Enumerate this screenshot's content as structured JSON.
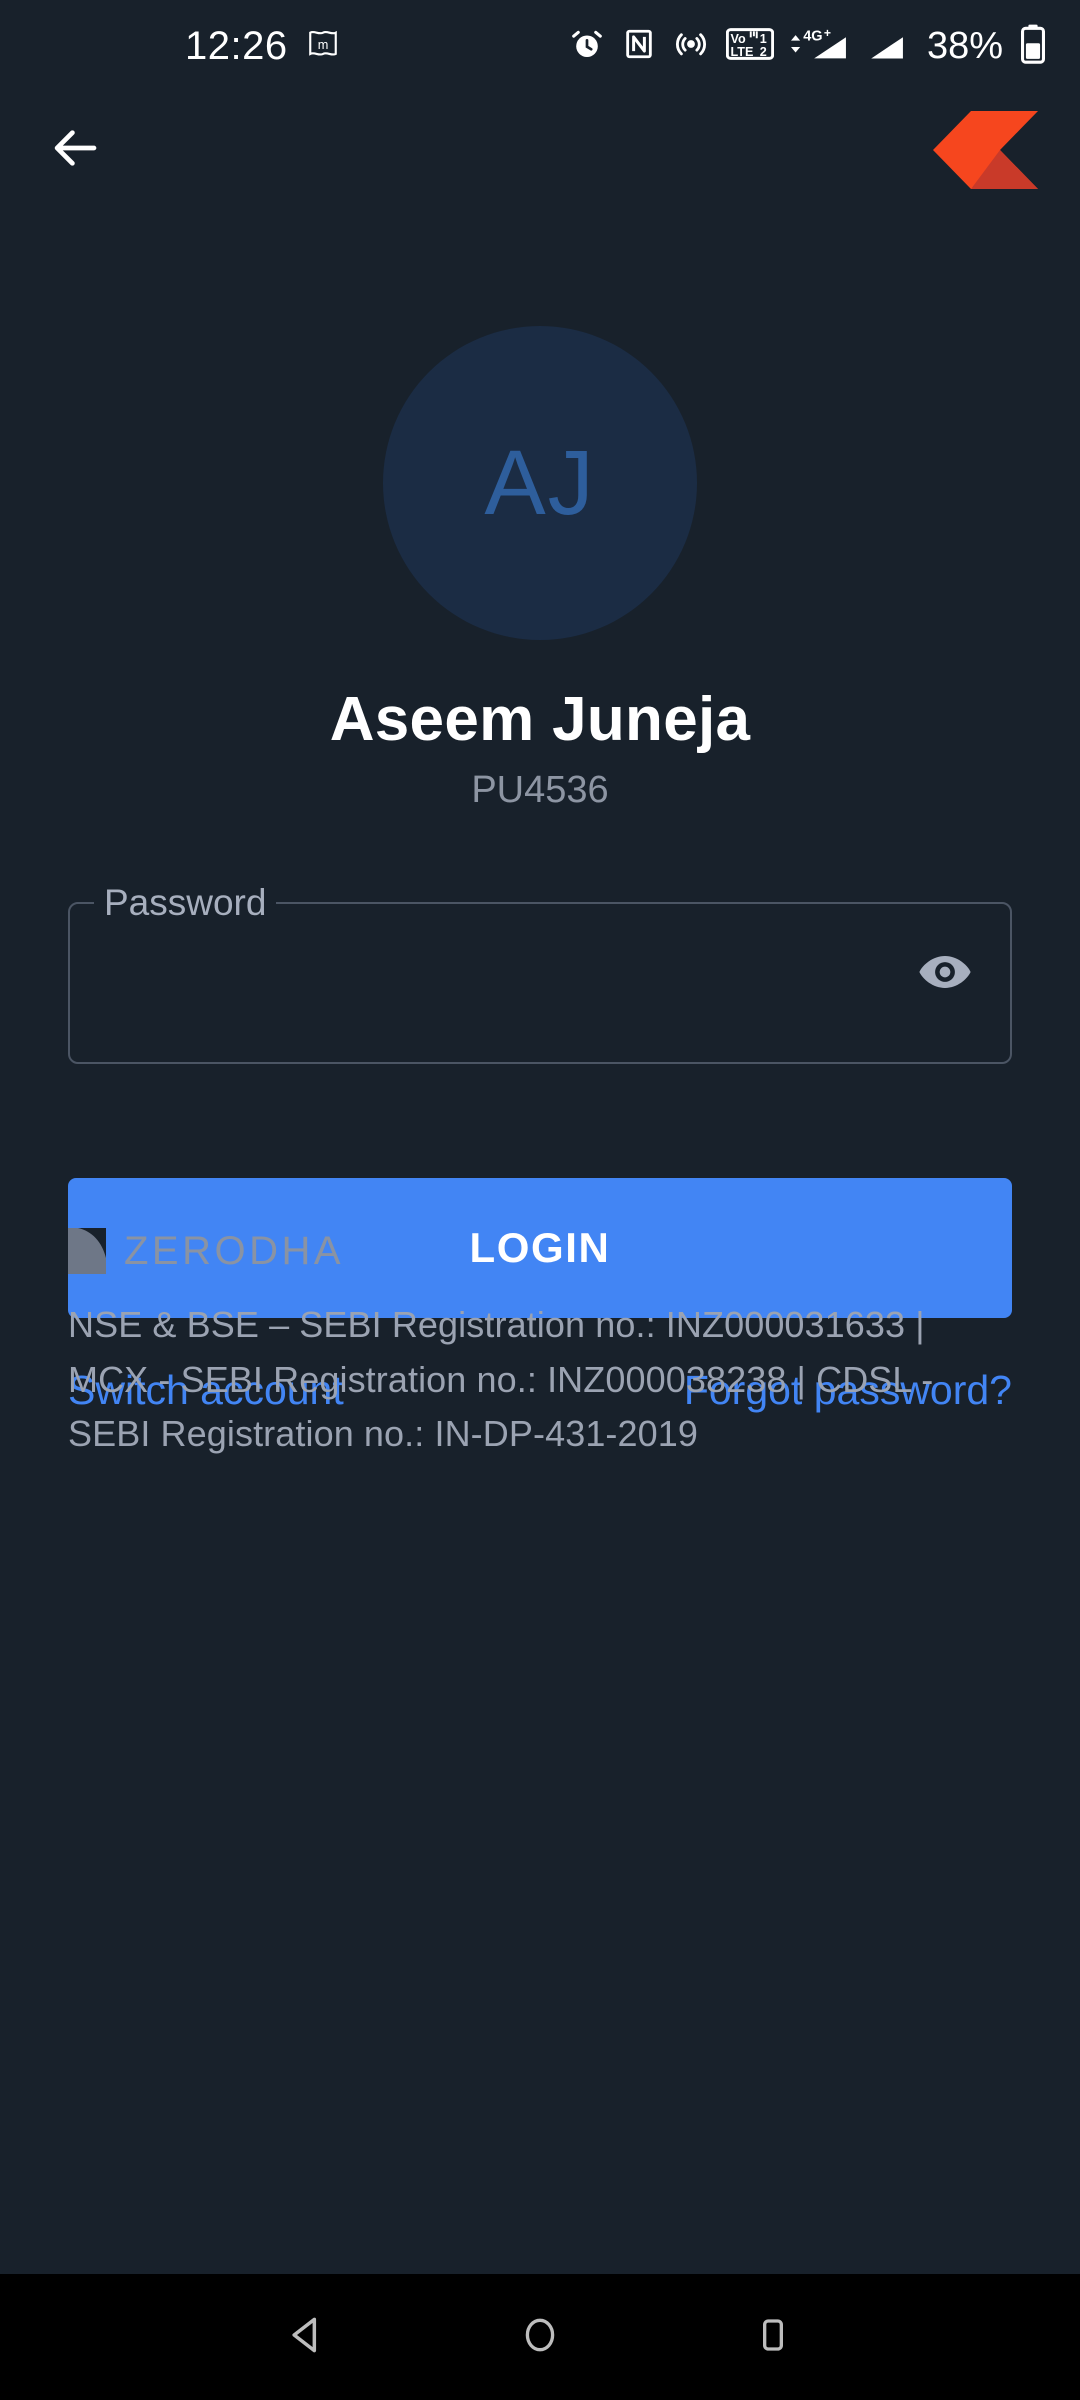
{
  "status_bar": {
    "time": "12:26",
    "notification_icon": "mastodon-flag-icon",
    "icons": [
      "alarm-icon",
      "nfc-icon",
      "hotspot-icon",
      "volte-dual-sim-icon",
      "signal-4g-plus-icon",
      "signal-sim2-icon"
    ],
    "battery_percent": "38%",
    "battery_icon": "battery-icon"
  },
  "app_bar": {
    "back_icon": "back-arrow-icon",
    "logo": "kite-logo",
    "logo_colors": {
      "primary": "#F6461E",
      "shadow": "#C93A29"
    }
  },
  "profile": {
    "initials": "AJ",
    "name": "Aseem Juneja",
    "user_id": "PU4536",
    "avatar_bg": "#1B2C44",
    "avatar_text_color": "#2E5E9C"
  },
  "form": {
    "password_label": "Password",
    "password_value": "",
    "password_placeholder": "",
    "toggle_visibility_icon": "eye-icon",
    "login_label": "LOGIN",
    "login_color": "#4285F4"
  },
  "links": {
    "switch_account": "Switch account",
    "forgot_password": "Forgot password?",
    "link_color": "#4285F4"
  },
  "footer": {
    "brand_mark": "zerodha-logo-icon",
    "brand_name": "ZERODHA",
    "legal": "NSE & BSE – SEBI Registration no.: INZ000031633 | MCX - SEBI Registration no.: INZ000038238 | CDSL - SEBI Registration no.: IN-DP-431-2019"
  },
  "nav_bar": {
    "back": "nav-back-icon",
    "home": "nav-home-icon",
    "recents": "nav-recents-icon"
  },
  "theme": {
    "background": "#18212B",
    "nav_background": "#000000"
  }
}
